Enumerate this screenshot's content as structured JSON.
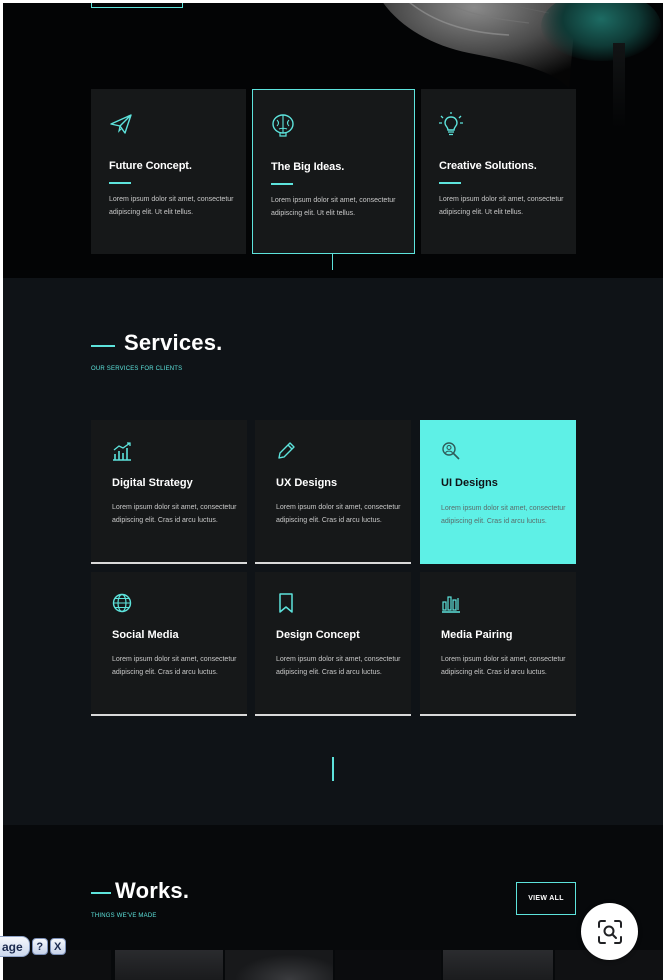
{
  "hero": {
    "features": [
      {
        "icon": "paper-plane-icon",
        "title": "Future Concept.",
        "text": "Lorem ipsum dolor sit amet, consectetur adipiscing elit. Ut elit tellus."
      },
      {
        "icon": "brain-icon",
        "title": "The Big Ideas.",
        "text": "Lorem ipsum dolor sit amet, consectetur adipiscing elit. Ut elit tellus."
      },
      {
        "icon": "lightbulb-icon",
        "title": "Creative Solutions.",
        "text": "Lorem ipsum dolor sit amet, consectetur adipiscing elit. Ut elit tellus."
      }
    ]
  },
  "services": {
    "title": "Services.",
    "subtitle": "OUR SERVICES FOR CLIENTS",
    "items": [
      {
        "icon": "bar-chart-icon",
        "title": "Digital Strategy",
        "text": "Lorem ipsum dolor sit amet, consectetur adipiscing elit. Cras id arcu luctus."
      },
      {
        "icon": "pencil-icon",
        "title": "UX Designs",
        "text": "Lorem ipsum dolor sit amet, consectetur adipiscing elit. Cras id arcu luctus."
      },
      {
        "icon": "search-user-icon",
        "title": "UI Designs",
        "text": "Lorem ipsum dolor sit amet, consectetur adipiscing elit. Cras id arcu luctus."
      },
      {
        "icon": "globe-icon",
        "title": "Social Media",
        "text": "Lorem ipsum dolor sit amet, consectetur adipiscing elit. Cras id arcu luctus."
      },
      {
        "icon": "bookmark-icon",
        "title": "Design Concept",
        "text": "Lorem ipsum dolor sit amet, consectetur adipiscing elit. Cras id arcu luctus."
      },
      {
        "icon": "equalizer-icon",
        "title": "Media Pairing",
        "text": "Lorem ipsum dolor sit amet, consectetur adipiscing elit. Cras id arcu luctus."
      }
    ]
  },
  "works": {
    "title": "Works.",
    "subtitle": "THINGS WE'VE MADE",
    "view_all_label": "VIEW ALL"
  },
  "overlay": {
    "page_label": "age",
    "help_label": "?",
    "close_label": "X",
    "lens_icon": "visual-search-icon"
  },
  "colors": {
    "accent": "#5de3dc",
    "active_card": "#5ef0e6",
    "background": "#0f1317",
    "card": "#161819"
  }
}
